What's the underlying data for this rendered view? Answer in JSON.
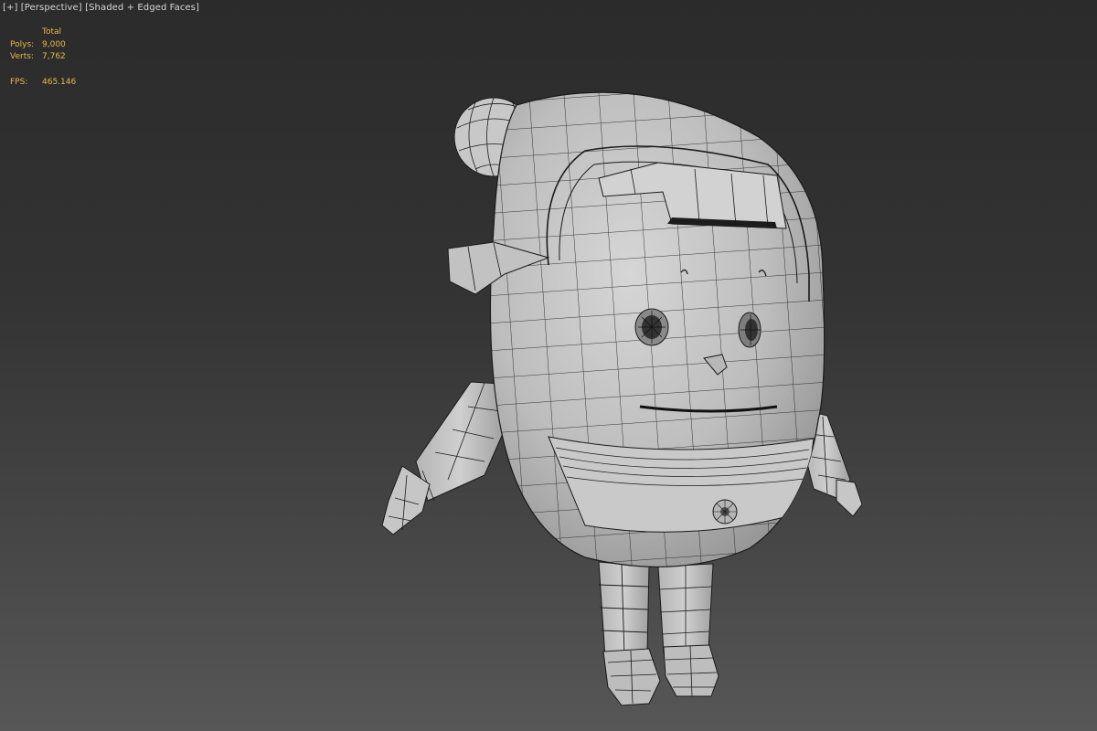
{
  "viewport": {
    "plus_menu": "[+]",
    "view_menu": "[Perspective]",
    "shading_menu": "[Shaded + Edged Faces]"
  },
  "stats": {
    "column_header": "Total",
    "polys_label": "Polys:",
    "polys_value": "9,000",
    "verts_label": "Verts:",
    "verts_value": "7,762",
    "fps_label": "FPS:",
    "fps_value": "465.146"
  },
  "colors": {
    "stats_text": "#e8b84a",
    "label_text": "#d6d6d6",
    "mesh_fill": "#c4c4c4",
    "wire": "#1a1a1a"
  }
}
